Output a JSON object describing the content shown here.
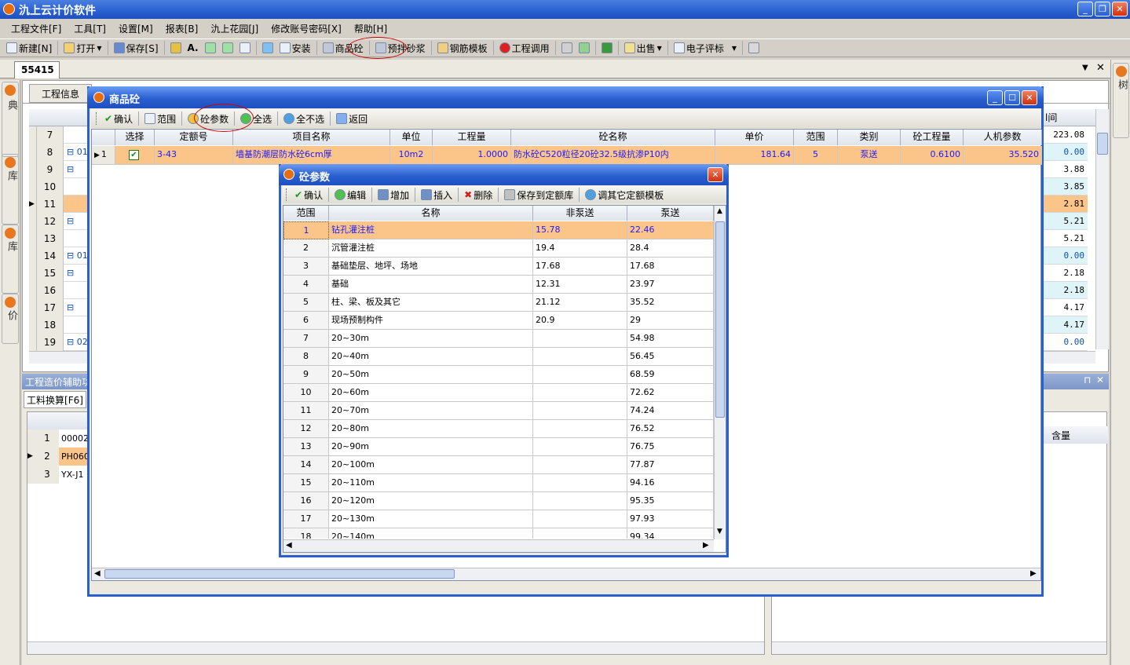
{
  "app": {
    "title": "氿上云计价软件"
  },
  "menu": [
    "工程文件[F]",
    "工具[T]",
    "设置[M]",
    "报表[B]",
    "氿上花园[J]",
    "修改账号密码[X]",
    "帮助[H]"
  ],
  "toolbar": [
    "新建[N]",
    "打开",
    "保存[S]",
    "安装",
    "商品砼",
    "预拌砂浆",
    "钢筋模板",
    "工程调用",
    "出售",
    "电子评标"
  ],
  "doc_tab": "55415",
  "left_tabs": [
    "工料机字典",
    "清单管理库",
    "定额管理库",
    "暂估价"
  ],
  "right_tab": "工程管理树",
  "main_tab": "工程信息",
  "bg_rows": [
    {
      "n": "7",
      "c": ""
    },
    {
      "n": "8",
      "c": "⊟ 01"
    },
    {
      "n": "9",
      "c": "⊟"
    },
    {
      "n": "10",
      "c": ""
    },
    {
      "n": "11",
      "c": ""
    },
    {
      "n": "12",
      "c": "⊟"
    },
    {
      "n": "13",
      "c": ""
    },
    {
      "n": "14",
      "c": "⊟ 01"
    },
    {
      "n": "15",
      "c": "⊟"
    },
    {
      "n": "16",
      "c": ""
    },
    {
      "n": "17",
      "c": "⊟"
    },
    {
      "n": "18",
      "c": ""
    },
    {
      "n": "19",
      "c": "⊟ 02"
    }
  ],
  "right_col_header": "l间",
  "right_col_values": [
    "223.08",
    "0.00",
    "3.88",
    "3.85",
    "2.81",
    "5.21",
    "5.21",
    "0.00",
    "2.18",
    "2.18",
    "4.17",
    "4.17",
    "0.00"
  ],
  "bottom_panel": {
    "title": "工程造价辅助功",
    "tab": "工料换算[F6]",
    "rows": [
      {
        "n": "1",
        "c": "00002("
      },
      {
        "n": "2",
        "c": "PH060"
      },
      {
        "n": "3",
        "c": "YX-J1"
      }
    ],
    "right_header": "含量"
  },
  "concrete_dialog": {
    "title": "商品砼",
    "toolbar": [
      "确认",
      "范围",
      "砼参数",
      "全选",
      "全不选",
      "返回"
    ],
    "headers": [
      "选择",
      "定额号",
      "项目名称",
      "单位",
      "工程量",
      "砼名称",
      "单价",
      "范围",
      "类别",
      "砼工程量",
      "人机参数"
    ],
    "row": {
      "index": "1",
      "code": "3-43",
      "name": "墙基防潮层防水砼6cm厚",
      "unit": "10m2",
      "qty": "1.0000",
      "concrete": "防水砼C520粒径20砼32.5级抗渗P10内",
      "price": "181.64",
      "range": "5",
      "type": "泵送",
      "cqty": "0.6100",
      "param": "35.520"
    }
  },
  "param_dialog": {
    "title": "砼参数",
    "toolbar": [
      "确认",
      "编辑",
      "增加",
      "插入",
      "删除",
      "保存到定额库",
      "调其它定额模板"
    ],
    "headers": [
      "范围",
      "名称",
      "非泵送",
      "泵送"
    ],
    "rows": [
      [
        "1",
        "钻孔灌注桩",
        "15.78",
        "22.46"
      ],
      [
        "2",
        "沉管灌注桩",
        "19.4",
        "28.4"
      ],
      [
        "3",
        "基础垫层、地坪、场地",
        "17.68",
        "17.68"
      ],
      [
        "4",
        "基础",
        "12.31",
        "23.97"
      ],
      [
        "5",
        "柱、梁、板及其它",
        "21.12",
        "35.52"
      ],
      [
        "6",
        "现场预制构件",
        "20.9",
        "29"
      ],
      [
        "7",
        "20~30m",
        "",
        "54.98"
      ],
      [
        "8",
        "20~40m",
        "",
        "56.45"
      ],
      [
        "9",
        "20~50m",
        "",
        "68.59"
      ],
      [
        "10",
        "20~60m",
        "",
        "72.62"
      ],
      [
        "11",
        "20~70m",
        "",
        "74.24"
      ],
      [
        "12",
        "20~80m",
        "",
        "76.52"
      ],
      [
        "13",
        "20~90m",
        "",
        "76.75"
      ],
      [
        "14",
        "20~100m",
        "",
        "77.87"
      ],
      [
        "15",
        "20~110m",
        "",
        "94.16"
      ],
      [
        "16",
        "20~120m",
        "",
        "95.35"
      ],
      [
        "17",
        "20~130m",
        "",
        "97.93"
      ],
      [
        "18",
        "20~140m",
        "",
        "99.34"
      ]
    ]
  },
  "colors": {
    "title_bar": "#2a5fd0",
    "selected_row": "#fbc58a",
    "highlight_text": "#1a1aff",
    "annotation": "#d00000"
  }
}
